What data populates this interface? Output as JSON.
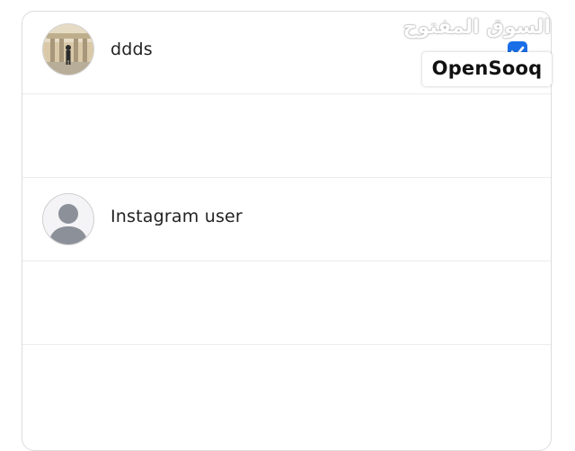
{
  "users": [
    {
      "name": "ddds",
      "avatar_icon": "profile-photo",
      "checked": true
    },
    {
      "name": "Instagram user",
      "avatar_icon": "default-person-icon",
      "checked": false
    }
  ],
  "watermark": {
    "arabic": "السوق المفتوح",
    "latin": "OpenSooq"
  },
  "colors": {
    "check_blue": "#1a6fe8",
    "avatar_gray": "#8c9099",
    "divider": "#ececec"
  }
}
